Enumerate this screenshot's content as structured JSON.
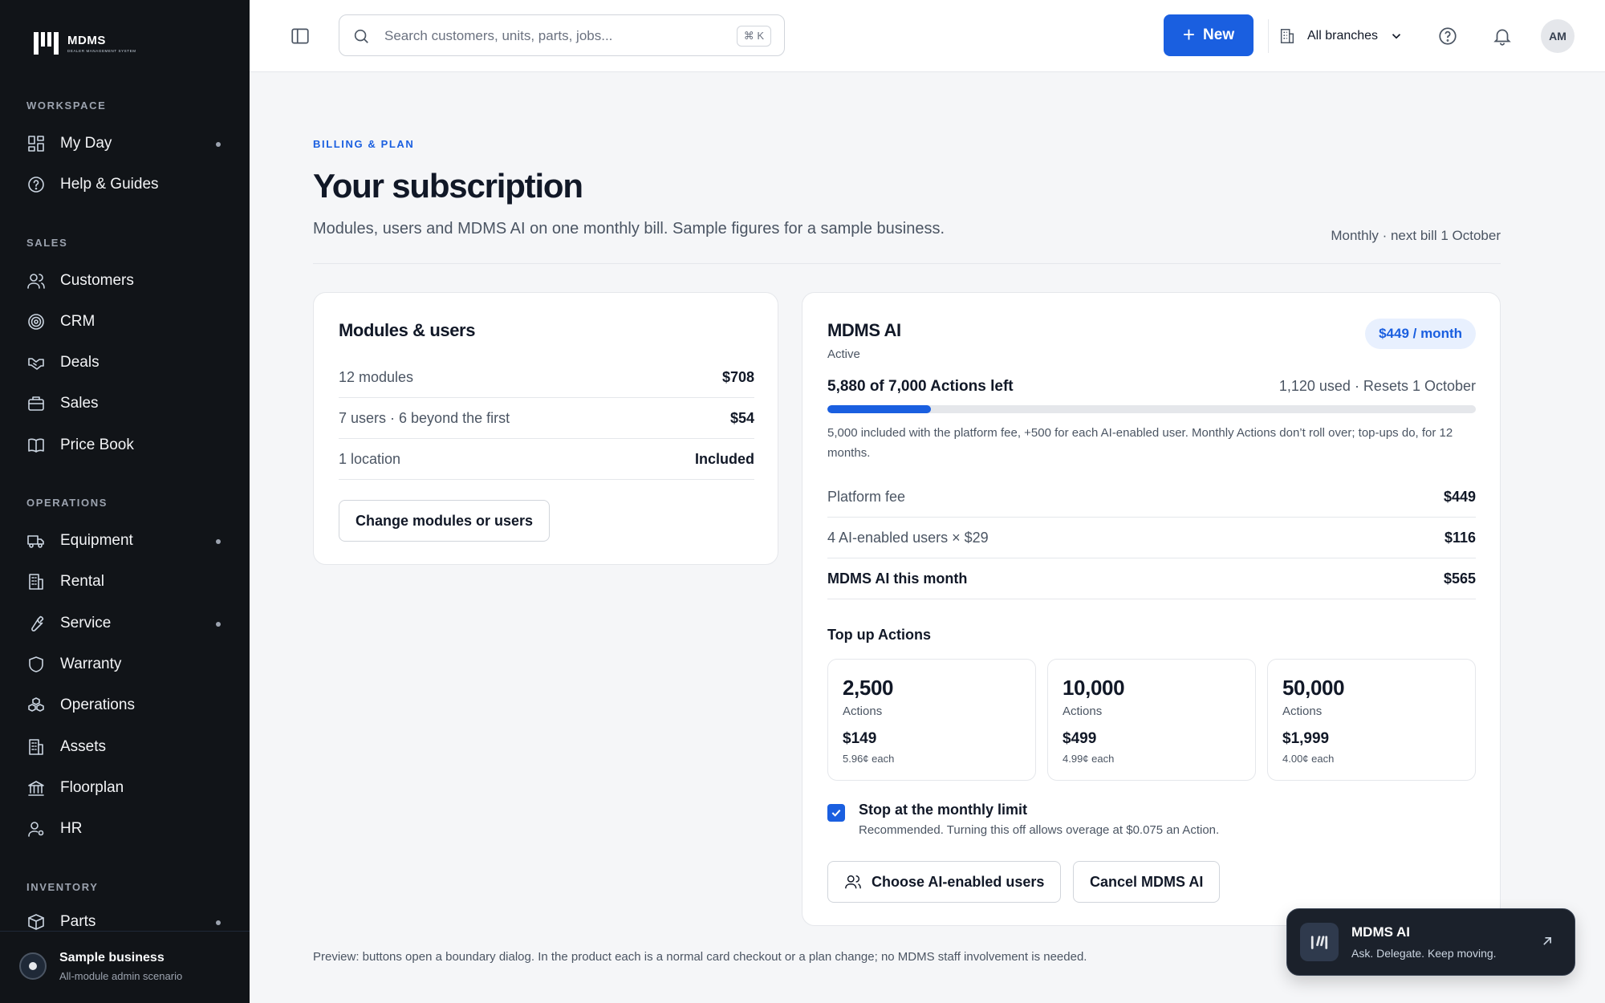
{
  "brand": {
    "name": "MDMS",
    "tagline": "DEALER MANAGEMENT SYSTEM"
  },
  "sidebar": {
    "sections": [
      {
        "label": "WORKSPACE",
        "items": [
          {
            "label": "My Day",
            "icon": "grid-icon",
            "dot": true
          },
          {
            "label": "Help & Guides",
            "icon": "help-circle-icon",
            "dot": false
          }
        ]
      },
      {
        "label": "SALES",
        "items": [
          {
            "label": "Customers",
            "icon": "users-icon",
            "dot": false
          },
          {
            "label": "CRM",
            "icon": "target-icon",
            "dot": false
          },
          {
            "label": "Deals",
            "icon": "handshake-icon",
            "dot": false
          },
          {
            "label": "Sales",
            "icon": "briefcase-icon",
            "dot": false
          },
          {
            "label": "Price Book",
            "icon": "book-icon",
            "dot": false
          }
        ]
      },
      {
        "label": "OPERATIONS",
        "items": [
          {
            "label": "Equipment",
            "icon": "truck-icon",
            "dot": true
          },
          {
            "label": "Rental",
            "icon": "building-icon",
            "dot": false
          },
          {
            "label": "Service",
            "icon": "wrench-icon",
            "dot": true
          },
          {
            "label": "Warranty",
            "icon": "shield-icon",
            "dot": false
          },
          {
            "label": "Operations",
            "icon": "boxes-icon",
            "dot": false
          },
          {
            "label": "Assets",
            "icon": "building-icon",
            "dot": false
          },
          {
            "label": "Floorplan",
            "icon": "bank-icon",
            "dot": false
          },
          {
            "label": "HR",
            "icon": "user-cog-icon",
            "dot": false
          }
        ]
      },
      {
        "label": "INVENTORY",
        "items": [
          {
            "label": "Parts",
            "icon": "package-icon",
            "dot": true
          }
        ]
      }
    ],
    "footer": {
      "name": "Sample business",
      "desc": "All-module admin scenario"
    }
  },
  "topbar": {
    "search_placeholder": "Search customers, units, parts, jobs...",
    "shortcut": "⌘ K",
    "new_label": "New",
    "branch_label": "All branches",
    "avatar_initials": "AM"
  },
  "page": {
    "eyebrow": "BILLING & PLAN",
    "title": "Your subscription",
    "subtitle": "Modules, users and MDMS AI on one monthly bill. Sample figures for a sample business.",
    "bill_cycle": "Monthly · next bill 1 October",
    "preview_note": "Preview: buttons open a boundary dialog. In the product each is a normal card checkout or a plan change; no MDMS staff involvement is needed."
  },
  "modules_card": {
    "title": "Modules & users",
    "rows": [
      {
        "label": "12 modules",
        "value": "$708"
      },
      {
        "label": "7 users · 6 beyond the first",
        "value": "$54"
      },
      {
        "label": "1 location",
        "value": "Included"
      }
    ],
    "change_button": "Change modules or users"
  },
  "ai_card": {
    "title": "MDMS AI",
    "status": "Active",
    "price_pill": "$449 / month",
    "actions_left": "5,880 of 7,000 Actions left",
    "actions_used": "1,120 used · Resets 1 October",
    "usage_fraction": 0.16,
    "note": "5,000 included with the platform fee, +500 for each AI-enabled user. Monthly Actions don’t roll over; top-ups do, for 12 months.",
    "rows": [
      {
        "label": "Platform fee",
        "value": "$449"
      },
      {
        "label": "4 AI-enabled users × $29",
        "value": "$116"
      },
      {
        "label": "MDMS AI this month",
        "value": "$565"
      }
    ],
    "topup_title": "Top up Actions",
    "packs": [
      {
        "amount": "2,500",
        "unit": "Actions",
        "price": "$149",
        "each": "5.96¢ each"
      },
      {
        "amount": "10,000",
        "unit": "Actions",
        "price": "$499",
        "each": "4.99¢ each"
      },
      {
        "amount": "50,000",
        "unit": "Actions",
        "price": "$1,999",
        "each": "4.00¢ each"
      }
    ],
    "limit_label": "Stop at the monthly limit",
    "limit_checked": true,
    "limit_hint": "Recommended. Turning this off allows overage at $0.075 an Action.",
    "choose_users_button": "Choose AI-enabled users",
    "cancel_button": "Cancel MDMS AI"
  },
  "ai_widget": {
    "title": "MDMS AI",
    "subtitle": "Ask. Delegate. Keep moving."
  },
  "colors": {
    "accent": "#1a5fe0",
    "sidebar_bg": "#111418",
    "page_bg": "#f5f6f8"
  }
}
